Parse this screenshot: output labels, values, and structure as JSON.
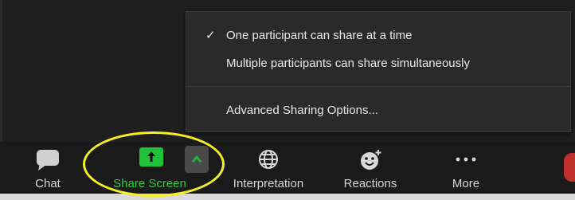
{
  "share_menu": {
    "items": [
      {
        "label": "One participant can share at a time",
        "checked": true
      },
      {
        "label": "Multiple participants can share simultaneously",
        "checked": false
      },
      {
        "label": "Advanced Sharing Options...",
        "checked": false
      }
    ],
    "check_glyph": "✓"
  },
  "toolbar": {
    "chat_label": "Chat",
    "share_label": "Share Screen",
    "interpretation_label": "Interpretation",
    "reactions_label": "Reactions",
    "more_label": "More"
  },
  "colors": {
    "share_green": "#20c23b",
    "highlight_yellow": "#f4f21a",
    "toolbar_bg": "#1a1a1a",
    "menu_bg": "#2a2a2a"
  },
  "icons": {
    "chat": "chat-bubble-icon",
    "share": "share-arrow-up-icon",
    "share_options": "chevron-up-icon",
    "interpretation": "globe-icon",
    "reactions": "emoji-add-icon",
    "more": "ellipsis-icon"
  }
}
